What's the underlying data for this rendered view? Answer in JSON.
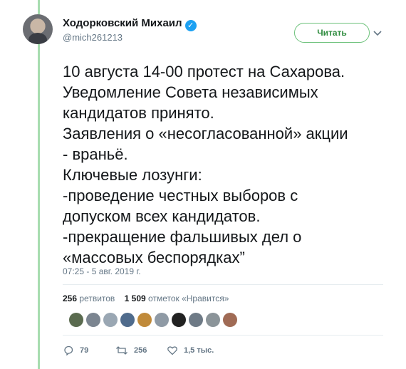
{
  "author": {
    "name": "Ходорковский Михаил",
    "handle": "@mich261213",
    "verified_icon": "check-badge-icon"
  },
  "follow_button": {
    "label": "Читать"
  },
  "tweet": {
    "text": "10 августа 14-00 протест на Сахарова.\nУведомление Совета независимых\nкандидатов принято.\nЗаявления о «несогласованной» акции\n- враньё.\nКлючевые лозунги:\n-проведение честных выборов с\nдопуском всех кандидатов.\n-прекращение фальшивых дел о\n«массовых беспорядках”",
    "timestamp": "07:25 - 5 авг. 2019 г."
  },
  "stats": {
    "retweets_count": "256",
    "retweets_label": "ретвитов",
    "likes_count": "1 509",
    "likes_label": "отметок «Нравится»"
  },
  "likers": [
    {
      "name": "liker-avatar",
      "color": "#5a6b4f"
    },
    {
      "name": "liker-avatar",
      "color": "#7b8590"
    },
    {
      "name": "liker-avatar",
      "color": "#9aa7b3"
    },
    {
      "name": "liker-avatar",
      "color": "#4f6b8c"
    },
    {
      "name": "liker-avatar",
      "color": "#c08a3a"
    },
    {
      "name": "liker-avatar",
      "color": "#8f9aa5"
    },
    {
      "name": "liker-avatar",
      "color": "#222222"
    },
    {
      "name": "liker-avatar",
      "color": "#6e7a86"
    },
    {
      "name": "liker-avatar",
      "color": "#8b9499"
    },
    {
      "name": "liker-avatar",
      "color": "#a06b55"
    }
  ],
  "actions": {
    "reply_count": "79",
    "retweet_count": "256",
    "like_count": "1,5 тыс."
  },
  "colors": {
    "thread_rail": "#a8ddb0",
    "follow_accent": "#2e8b3e",
    "verified": "#1da1f2"
  }
}
